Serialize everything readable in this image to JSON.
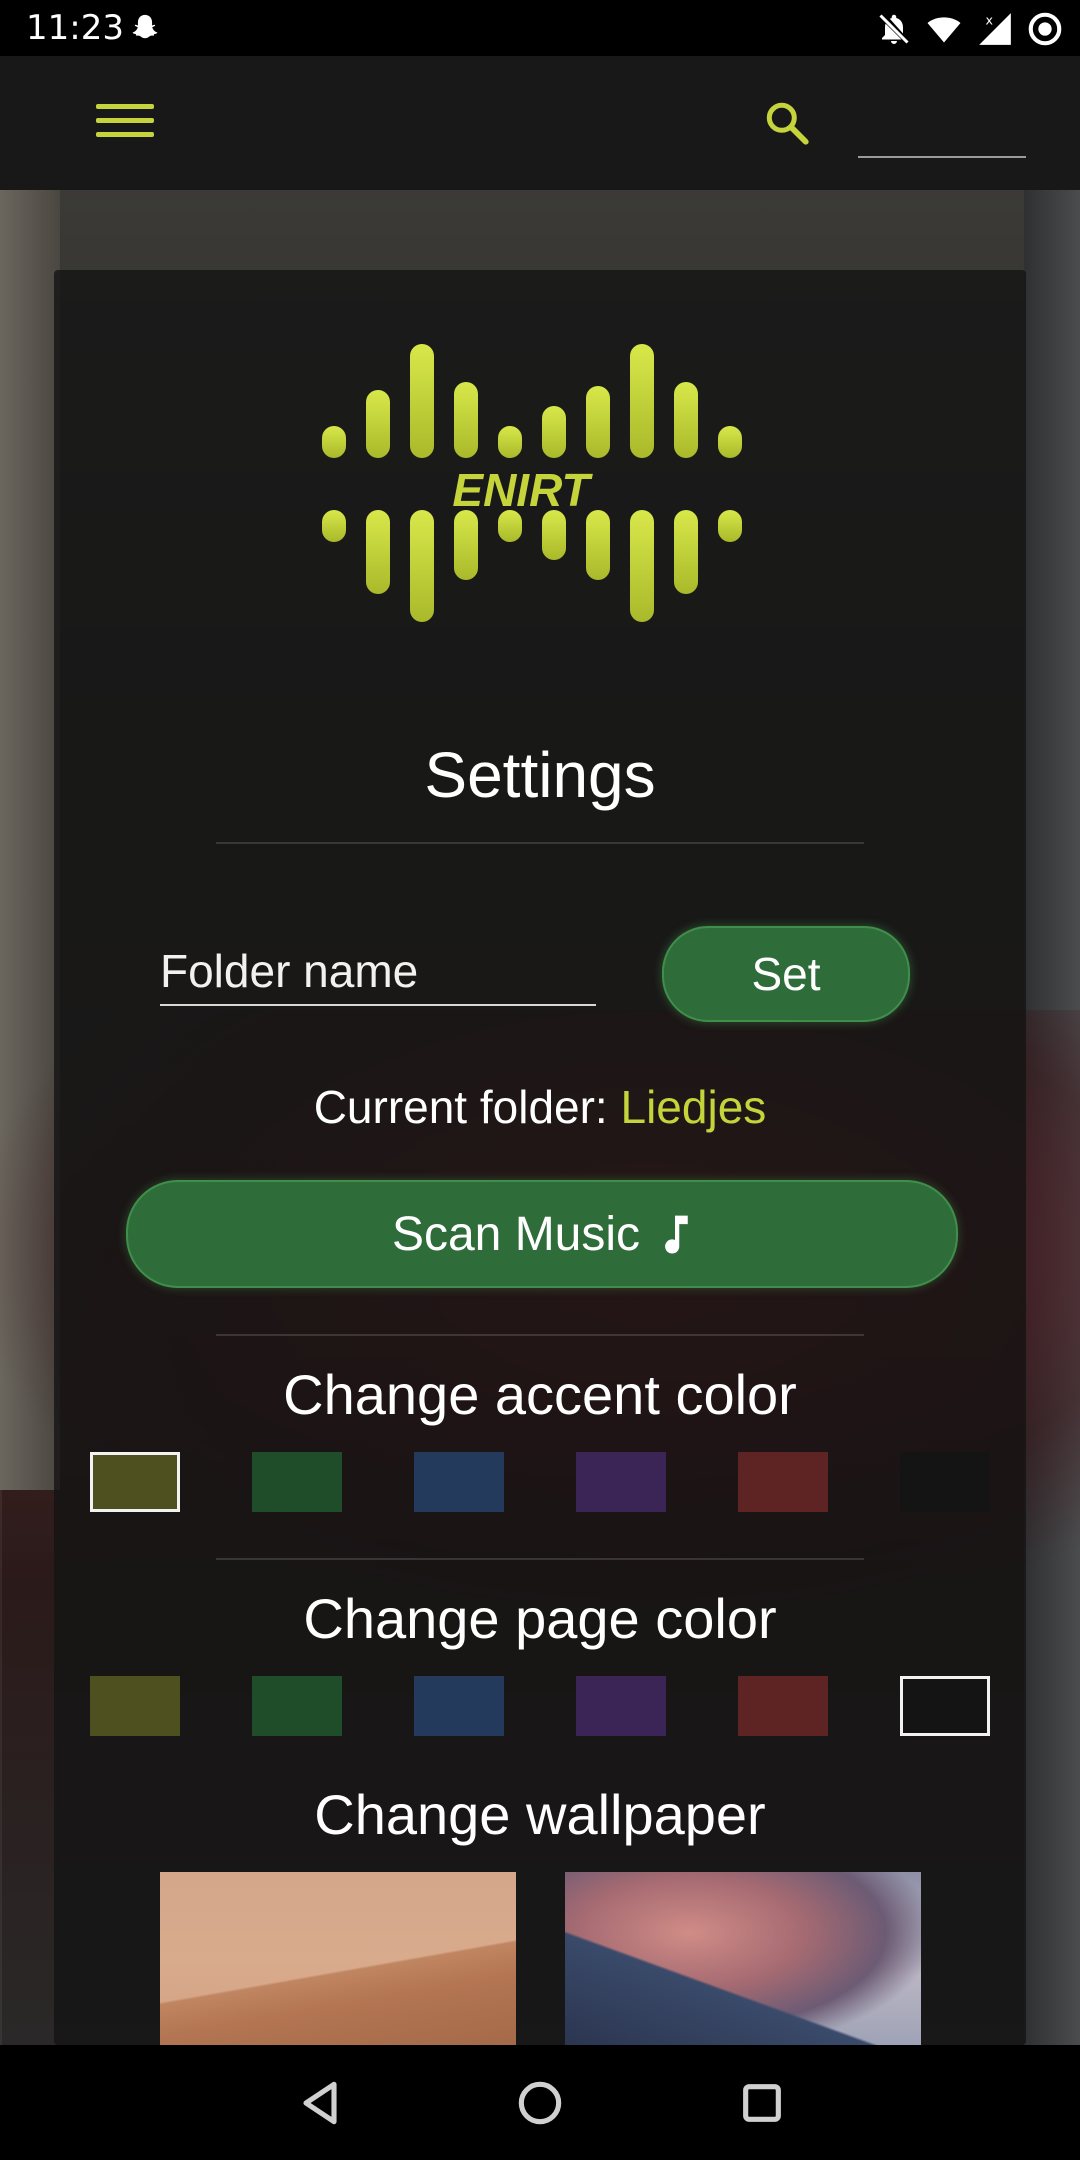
{
  "status_bar": {
    "time": "11:23",
    "icons": [
      "snapchat-icon",
      "notifications-off-icon",
      "wifi-icon",
      "cellular-x-icon",
      "data-saver-icon"
    ]
  },
  "toolbar": {
    "menu_icon": "hamburger-menu-icon",
    "search_icon": "search-icon",
    "accent_color": "#c5d43b"
  },
  "logo": {
    "text": "ENIRT"
  },
  "settings": {
    "title": "Settings",
    "folder_placeholder": "Folder name",
    "set_label": "Set",
    "current_folder_label": "Current folder:",
    "current_folder_value": "Liedjes",
    "scan_label": "Scan Music",
    "scan_icon": "music-note-icon",
    "button_color": "#2e6d3a"
  },
  "accent_color_section": {
    "title": "Change accent color",
    "swatches": [
      {
        "color": "#4e5020",
        "selected": true
      },
      {
        "color": "#1f4d2a",
        "selected": false
      },
      {
        "color": "#243a5c",
        "selected": false
      },
      {
        "color": "#3b2456",
        "selected": false
      },
      {
        "color": "#5e2424",
        "selected": false
      },
      {
        "color": "#141414",
        "selected": false
      }
    ]
  },
  "page_color_section": {
    "title": "Change page color",
    "swatches": [
      {
        "color": "#4e5020",
        "selected": false
      },
      {
        "color": "#1f4d2a",
        "selected": false
      },
      {
        "color": "#243a5c",
        "selected": false
      },
      {
        "color": "#3b2456",
        "selected": false
      },
      {
        "color": "#5e2424",
        "selected": false
      },
      {
        "color": "#141414",
        "selected": true
      }
    ]
  },
  "wallpaper_section": {
    "title": "Change wallpaper",
    "thumbnails": [
      "desert-dunes",
      "mountain-clouds"
    ]
  },
  "nav_bar": {
    "buttons": [
      "back-icon",
      "home-icon",
      "recents-icon"
    ]
  }
}
